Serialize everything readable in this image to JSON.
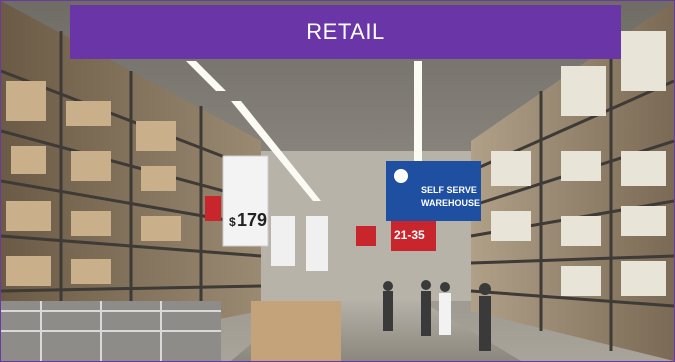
{
  "banner": {
    "title": "RETAIL"
  },
  "signs": {
    "price_left": "179",
    "price_left_currency": "$",
    "price_red": "21-35",
    "hanging_blue_line1": "SELF SERVE",
    "hanging_blue_line2": "WAREHOUSE"
  },
  "colors": {
    "banner": "#6a35a6",
    "blue_sign": "#1f4fa0",
    "red_sign": "#c8252d"
  }
}
